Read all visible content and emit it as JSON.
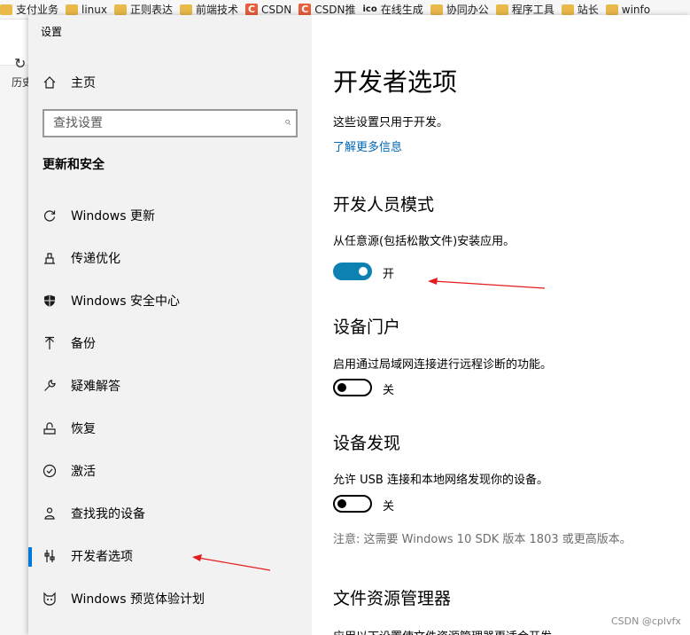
{
  "bookmarks": [
    {
      "label": "支付业务",
      "icon": "folder-icon"
    },
    {
      "label": "linux",
      "icon": "folder-icon"
    },
    {
      "label": "正则表达",
      "icon": "folder-icon"
    },
    {
      "label": "前端技术",
      "icon": "folder-icon"
    },
    {
      "label": "CSDN",
      "icon": "csdn-icon"
    },
    {
      "label": "CSDN推",
      "icon": "csdn-icon"
    },
    {
      "label": "在线生成",
      "icon": "ico-icon",
      "badge": "ico"
    },
    {
      "label": "协同办公",
      "icon": "folder-icon"
    },
    {
      "label": "程序工具",
      "icon": "folder-icon"
    },
    {
      "label": "站长",
      "icon": "folder-icon"
    },
    {
      "label": "winfo",
      "icon": "folder-icon"
    }
  ],
  "browser": {
    "history_label": "历史"
  },
  "window": {
    "title": "设置"
  },
  "sidebar": {
    "home_label": "主页",
    "search_placeholder": "查找设置",
    "section_title": "更新和安全",
    "items": [
      {
        "label": "Windows 更新",
        "icon": "refresh-icon"
      },
      {
        "label": "传递优化",
        "icon": "delivery-icon"
      },
      {
        "label": "Windows 安全中心",
        "icon": "shield-icon"
      },
      {
        "label": "备份",
        "icon": "backup-icon"
      },
      {
        "label": "疑难解答",
        "icon": "wrench-icon"
      },
      {
        "label": "恢复",
        "icon": "recovery-icon"
      },
      {
        "label": "激活",
        "icon": "check-circle-icon"
      },
      {
        "label": "查找我的设备",
        "icon": "person-location-icon"
      },
      {
        "label": "开发者选项",
        "icon": "developer-icon",
        "selected": true
      },
      {
        "label": "Windows 预览体验计划",
        "icon": "insider-cat-icon"
      }
    ]
  },
  "content": {
    "title": "开发者选项",
    "intro": "这些设置只用于开发。",
    "learn_more": "了解更多信息",
    "dev_mode": {
      "heading": "开发人员模式",
      "desc": "从任意源(包括松散文件)安装应用。",
      "state_label": "开",
      "on": true
    },
    "device_portal": {
      "heading": "设备门户",
      "desc": "启用通过局域网连接进行远程诊断的功能。",
      "state_label": "关",
      "on": false
    },
    "device_discovery": {
      "heading": "设备发现",
      "desc": "允许 USB 连接和本地网络发现你的设备。",
      "state_label": "关",
      "on": false,
      "note": "注意: 这需要 Windows 10 SDK 版本 1803 或更高版本。"
    },
    "file_explorer": {
      "heading": "文件资源管理器",
      "desc": "应用以下设置使文件资源管理器更适合开发。"
    }
  },
  "watermark": "CSDN @cplvfx",
  "colors": {
    "accent": "#0078d7",
    "toggle_on": "#0e81b3",
    "link": "#0067b8",
    "annotation": "#e31b1b"
  }
}
